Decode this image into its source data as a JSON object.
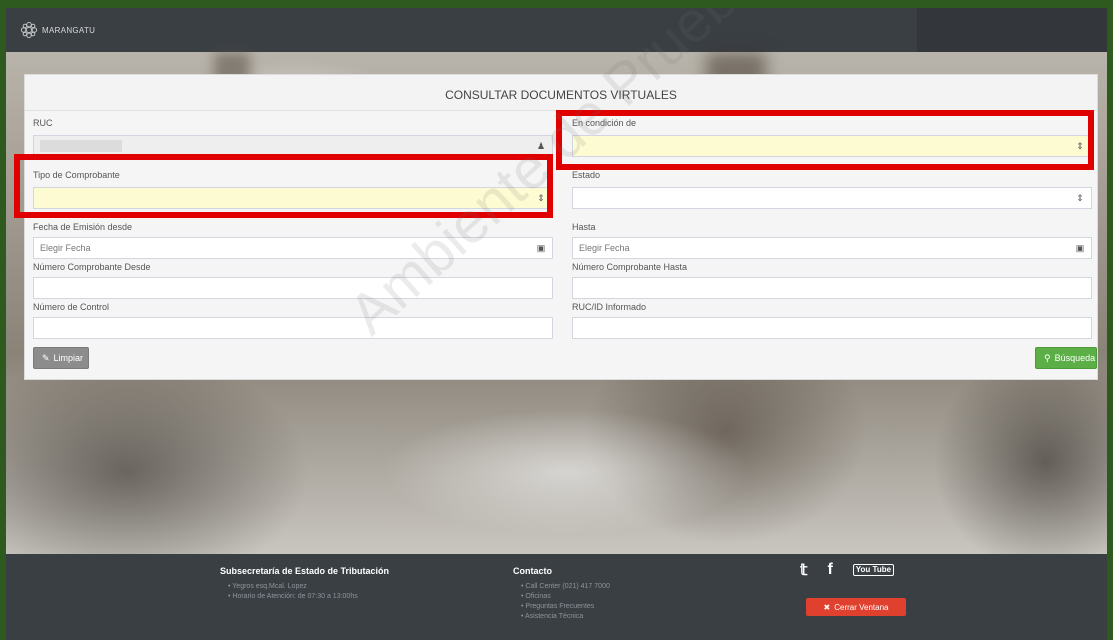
{
  "header": {
    "brand": "MARANGATU"
  },
  "panel": {
    "title": "CONSULTAR DOCUMENTOS VIRTUALES",
    "fields": {
      "ruc": {
        "label": "RUC",
        "value": ""
      },
      "condicion": {
        "label": "En condición de",
        "value": ""
      },
      "tipo_comprobante": {
        "label": "Tipo de Comprobante",
        "value": ""
      },
      "estado": {
        "label": "Estado",
        "value": ""
      },
      "fecha_desde": {
        "label": "Fecha de Emisión desde",
        "placeholder": "Elegir Fecha"
      },
      "hasta": {
        "label": "Hasta",
        "placeholder": "Elegir Fecha"
      },
      "num_desde": {
        "label": "Número Comprobante Desde",
        "value": ""
      },
      "num_hasta": {
        "label": "Número Comprobante Hasta",
        "value": ""
      },
      "num_control": {
        "label": "Número de Control",
        "value": ""
      },
      "ruc_informado": {
        "label": "RUC/ID Informado",
        "value": ""
      }
    },
    "buttons": {
      "clear": "Limpiar",
      "search": "Búsqueda"
    }
  },
  "watermark": "Ambiente de Prueba",
  "footer": {
    "col1": {
      "title": "Subsecretaría de Estado de Tributación",
      "items": [
        "Yegros esq.Mcal. Lopez",
        "Horario de Atención: de 07:30 a 13:00hs"
      ]
    },
    "col2": {
      "title": "Contacto",
      "items": [
        "Call Center (021) 417 7000",
        "Oficinas",
        "Preguntas Frecuentes",
        "Asistencia Técnica"
      ]
    },
    "close_button": "Cerrar Ventana",
    "youtube_label": "You Tube"
  },
  "colors": {
    "accent_green": "#5cae47",
    "highlight": "#e00000",
    "close_red": "#e0402e"
  }
}
